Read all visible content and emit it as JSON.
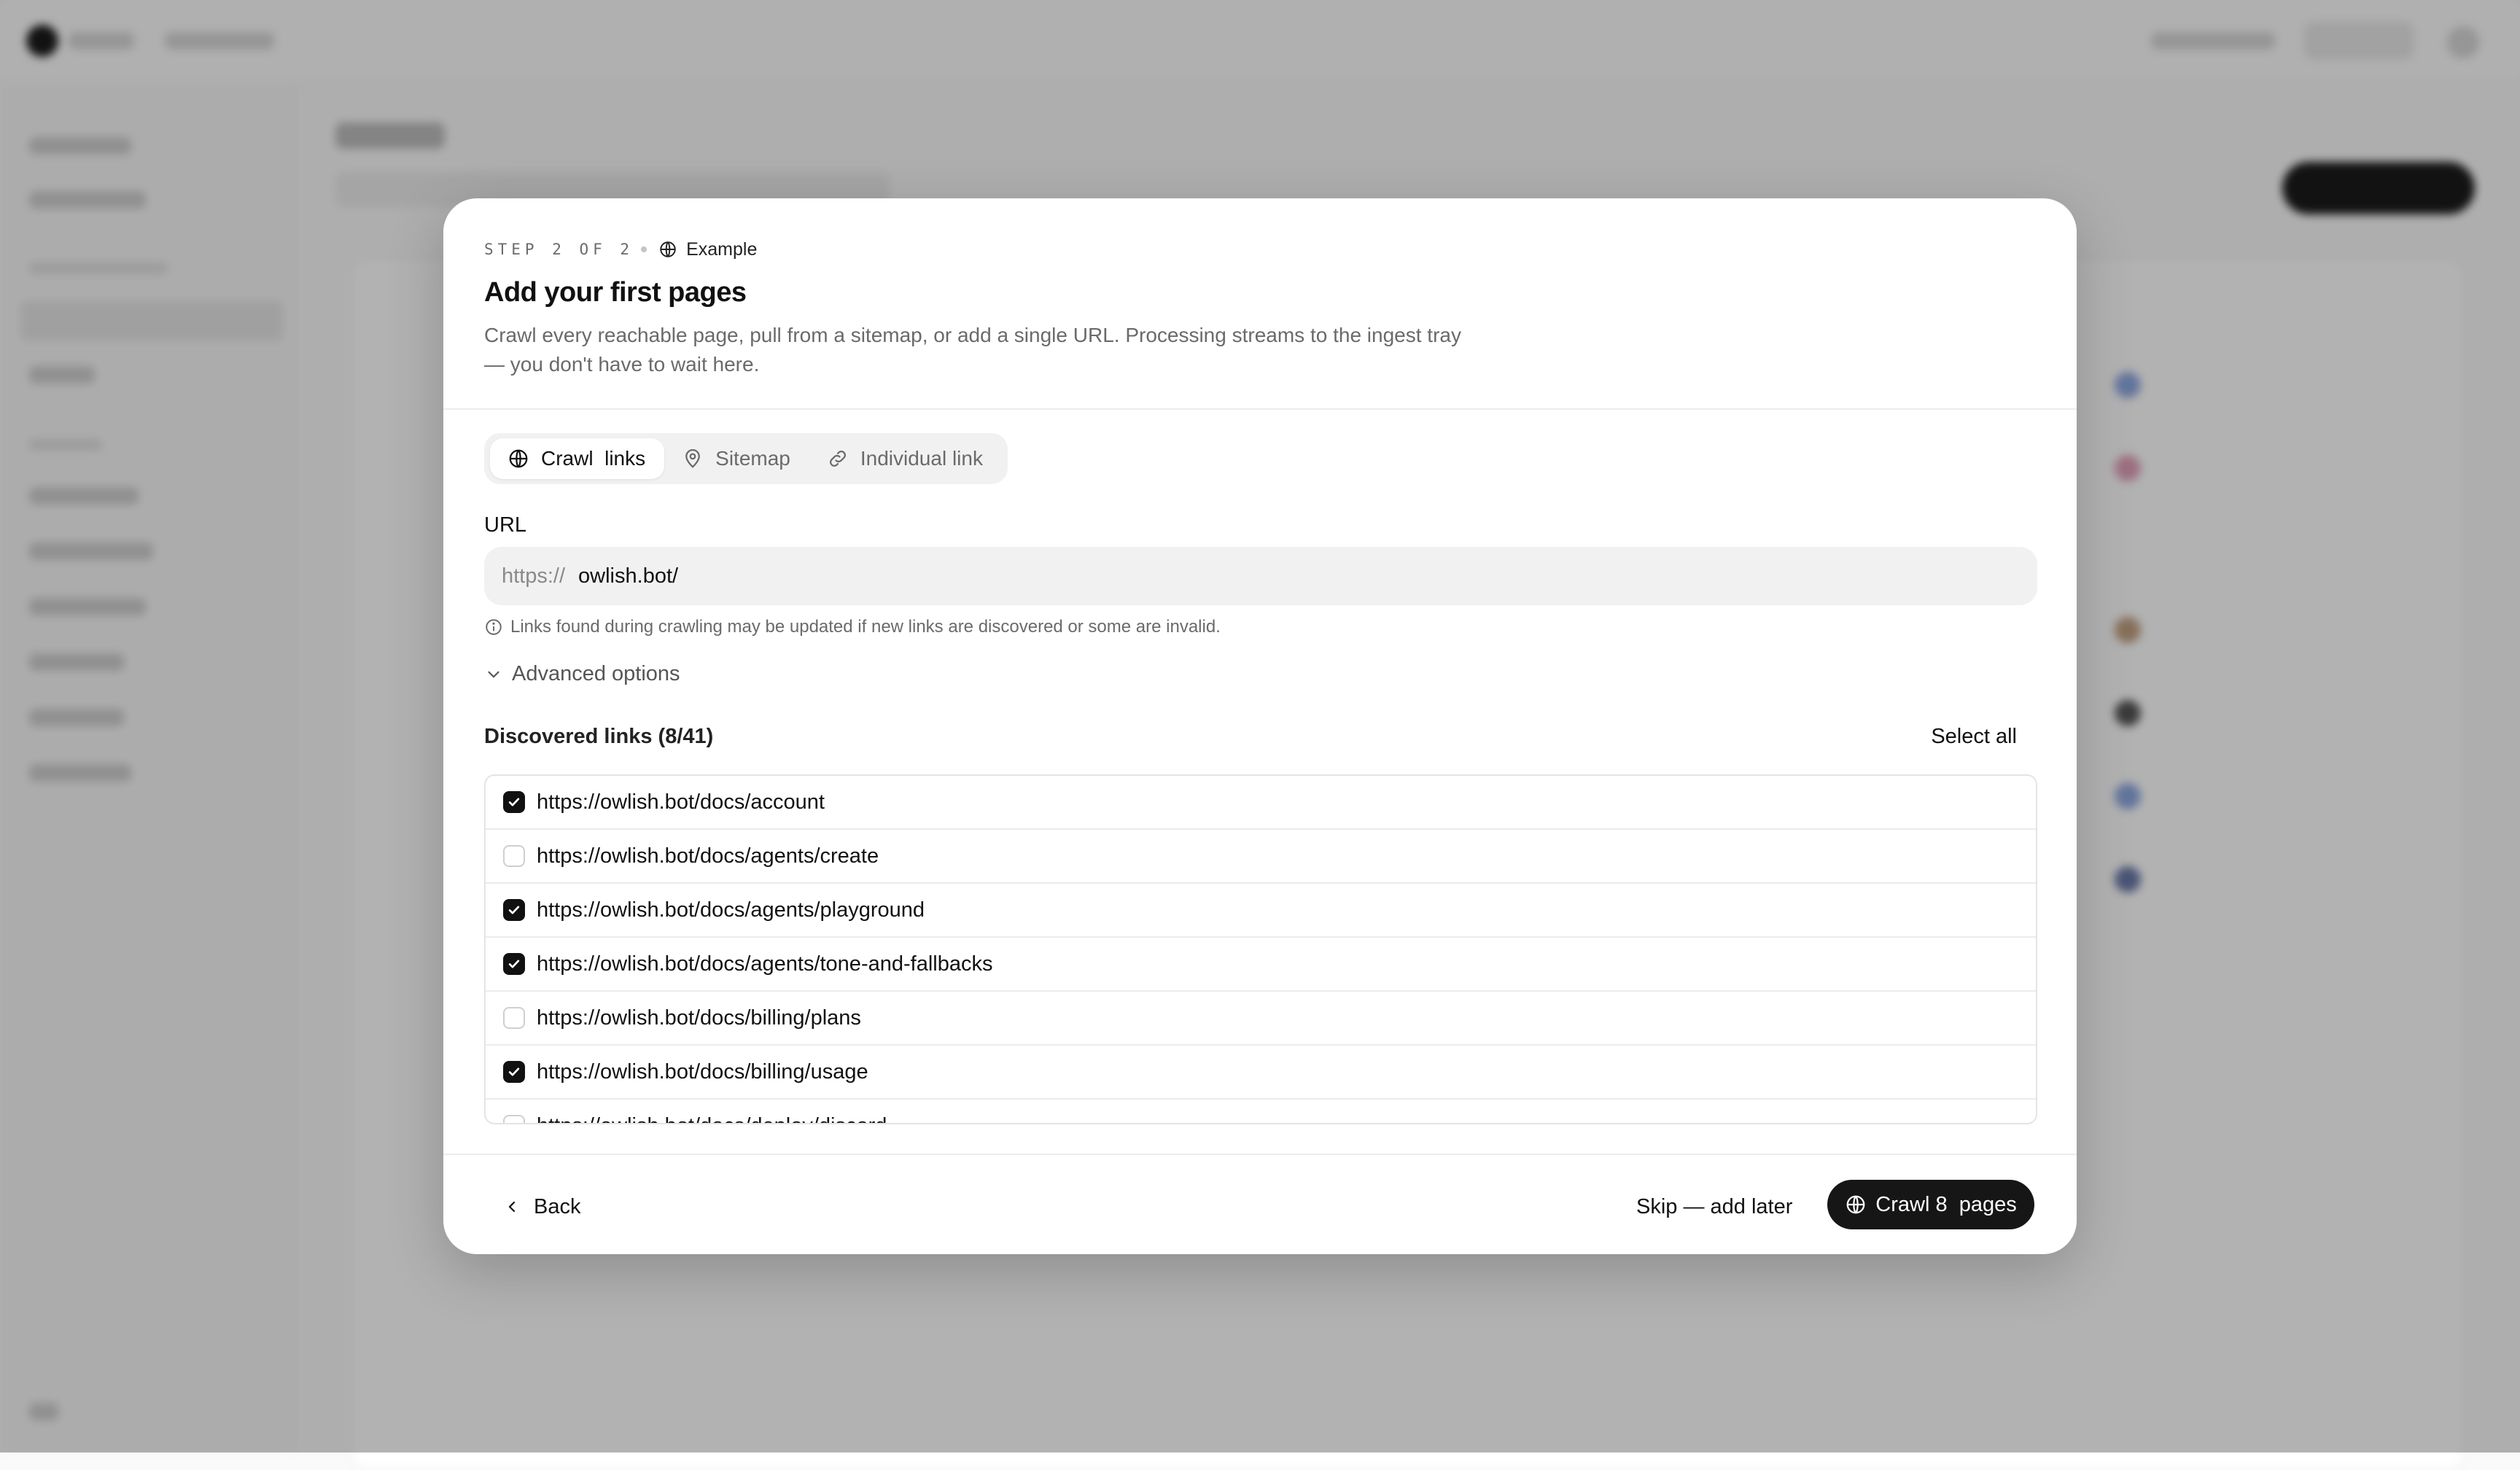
{
  "modal": {
    "step_label": "STEP 2 OF 2",
    "source_name": "Example",
    "title": "Add your first pages",
    "description": "Crawl every reachable page, pull from a sitemap, or add a single URL. Processing streams to the ingest tray — you don't have to wait here.",
    "tabs": [
      {
        "label": "Crawl  links",
        "icon": "globe-icon",
        "active": true
      },
      {
        "label": "Sitemap",
        "icon": "map-pin-icon",
        "active": false
      },
      {
        "label": "Individual link",
        "icon": "link-icon",
        "active": false
      }
    ],
    "url": {
      "label": "URL",
      "prefix": "https://",
      "value": "owlish.bot/",
      "hint": "Links found during crawling may be updated if new links are discovered or some are invalid."
    },
    "advanced_label": "Advanced options",
    "discovered": {
      "title": "Discovered links (8/41)",
      "select_all": "Select all",
      "links": [
        {
          "url": "https://owlish.bot/docs/account",
          "checked": true
        },
        {
          "url": "https://owlish.bot/docs/agents/create",
          "checked": false
        },
        {
          "url": "https://owlish.bot/docs/agents/playground",
          "checked": true
        },
        {
          "url": "https://owlish.bot/docs/agents/tone-and-fallbacks",
          "checked": true
        },
        {
          "url": "https://owlish.bot/docs/billing/plans",
          "checked": false
        },
        {
          "url": "https://owlish.bot/docs/billing/usage",
          "checked": true
        },
        {
          "url": "https://owlish.bot/docs/deploy/discord",
          "checked": false
        }
      ]
    },
    "footer": {
      "back": "Back",
      "skip": "Skip — add later",
      "crawl": "Crawl 8  pages"
    }
  },
  "colors": {
    "accent": "#161616",
    "overlay": "rgba(0,0,0,0.30)"
  }
}
